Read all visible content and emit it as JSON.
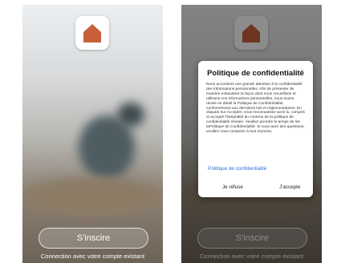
{
  "screens": {
    "left": {
      "register_button": "S'inscire",
      "login_link": "Connection avec votre compte existant"
    },
    "right": {
      "register_button": "S'inscire",
      "login_link": "Connection avec votre compte existant",
      "dialog": {
        "title": "Politique de confidentialité",
        "body": "Nous accordons une grande attention à la confidentialité des informations personnelles. Afin de présenter de manière exhaustive la façon dont nous recueillons et utilisons vos informations personnelles, nous avons révisé en détail la Politique de Confidentialité, conformément aux dernières lois et réglementations. En cliquant sur Accepter, vous reconnaissez avoir lu, compris et accepté l'intégralité du contenu de la politique de confidentialité révisée. Veuillez prendre le temps de lire laPolitique de Confidentialité. Si vous avez des questions, veuillez nous contacter à tout moment.",
        "policy_link": "Politique de confidentialité",
        "refuse_button": "Je réfuse",
        "accept_button": "J'accepte"
      }
    }
  },
  "colors": {
    "logo_shape": "#c8603c",
    "link": "#2e6fd1"
  },
  "icons": {
    "logo": "house-icon"
  }
}
